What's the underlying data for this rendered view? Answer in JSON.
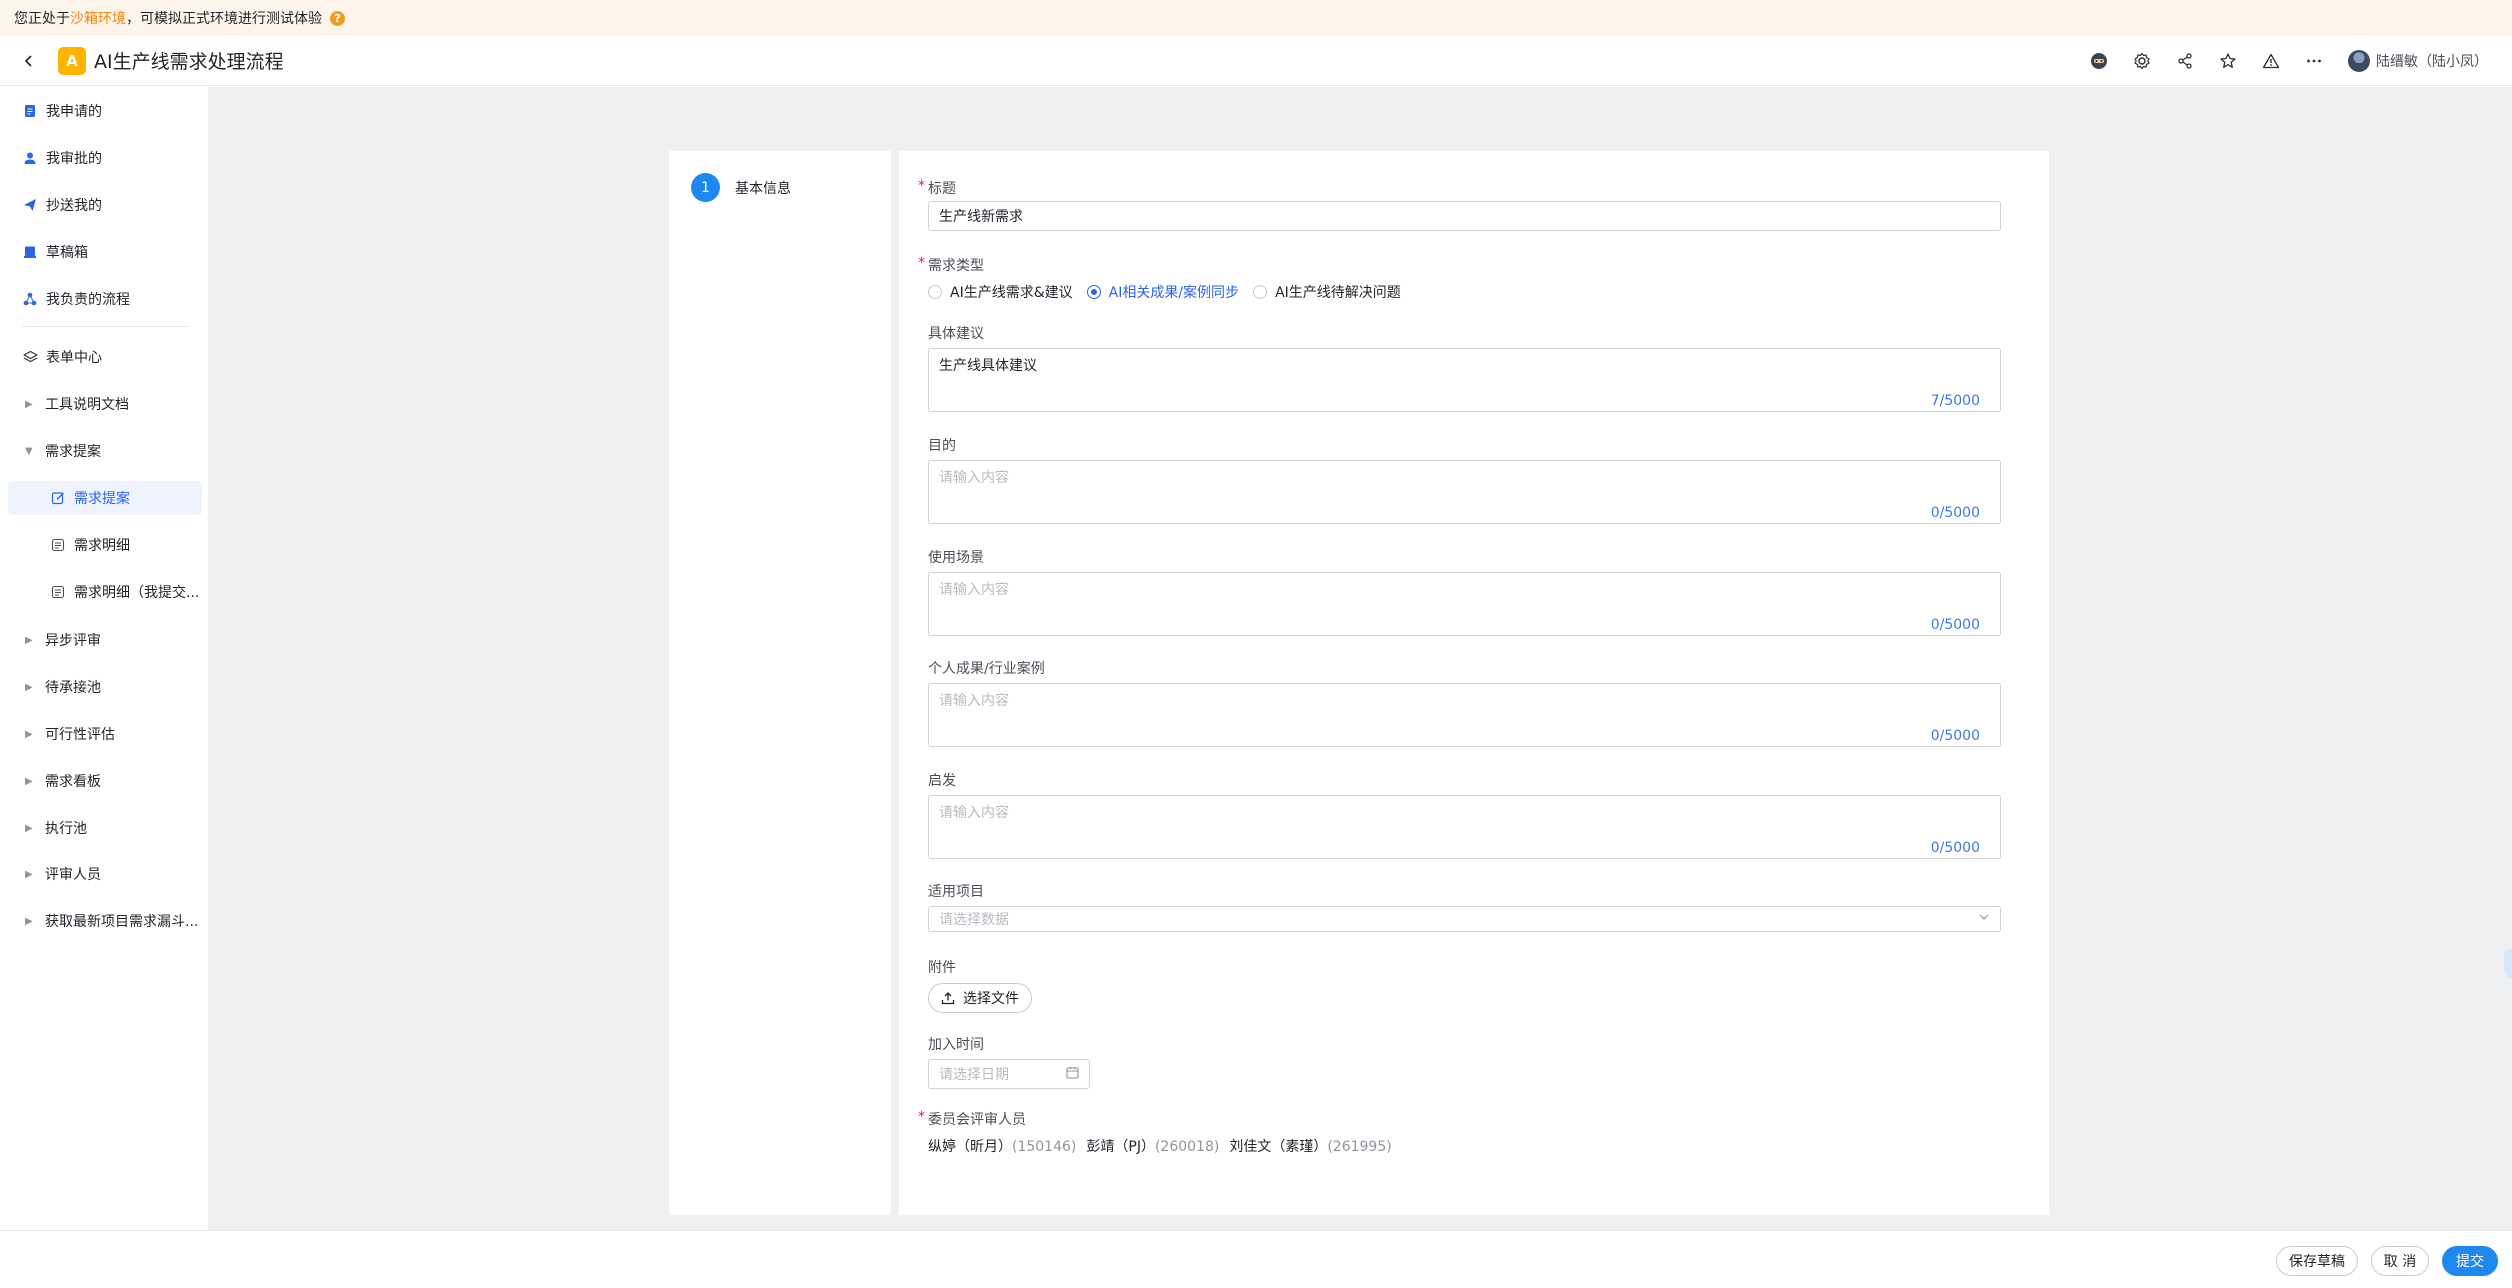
{
  "banner": {
    "prefix": "您正处于",
    "highlight": "沙箱环境",
    "suffix": "，可模拟正式环境进行测试体验",
    "help": "?"
  },
  "header": {
    "logo": "A",
    "title": "AI生产线需求处理流程",
    "user": "陆缙敏（陆小凤）"
  },
  "sidebar": {
    "my_applied": "我申请的",
    "my_approved": "我审批的",
    "cc_me": "抄送我的",
    "drafts": "草稿箱",
    "my_flows": "我负责的流程",
    "form_center": "表单中心",
    "tool_docs": "工具说明文档",
    "req_proposal_group": "需求提案",
    "req_proposal": "需求提案",
    "req_detail": "需求明细",
    "req_detail_mine": "需求明细（我提交...",
    "async_review": "异步评审",
    "pending_pool": "待承接池",
    "feasibility": "可行性评估",
    "req_board": "需求看板",
    "exec_pool": "执行池",
    "reviewers": "评审人员",
    "latest_projects": "获取最新项目需求漏斗..."
  },
  "steps": [
    {
      "num": "1",
      "label": "基本信息"
    }
  ],
  "form": {
    "title_label": "标题",
    "title_value": "生产线新需求",
    "type_label": "需求类型",
    "type_options": [
      "AI生产线需求&建议",
      "AI相关成果/案例同步",
      "AI生产线待解决问题"
    ],
    "type_selected": "AI相关成果/案例同步",
    "suggestion_label": "具体建议",
    "suggestion_value": "生产线具体建议",
    "suggestion_count": "7/5000",
    "purpose_label": "目的",
    "purpose_placeholder": "请输入内容",
    "purpose_count": "0/5000",
    "scenario_label": "使用场景",
    "scenario_placeholder": "请输入内容",
    "scenario_count": "0/5000",
    "case_label": "个人成果/行业案例",
    "case_placeholder": "请输入内容",
    "case_count": "0/5000",
    "inspiration_label": "启发",
    "inspiration_placeholder": "请输入内容",
    "inspiration_count": "0/5000",
    "project_label": "适用项目",
    "project_placeholder": "请选择数据",
    "attachment_label": "附件",
    "upload_label": "选择文件",
    "join_time_label": "加入时间",
    "date_placeholder": "请选择日期",
    "committee_label": "委员会评审人员",
    "reviewers": [
      {
        "name": "纵婷（昕月）",
        "id": "(150146)"
      },
      {
        "name": "彭靖（PJ）",
        "id": "(260018)"
      },
      {
        "name": "刘佳文（素瑾）",
        "id": "(261995)"
      }
    ]
  },
  "footer": {
    "save_draft": "保存草稿",
    "cancel": "取 消",
    "submit": "提交"
  },
  "colors": {
    "accent": "#2c64e8",
    "primary_button": "#1e88f0",
    "banner_bg": "#fdf4ec",
    "main_bg": "#eff0f2"
  }
}
